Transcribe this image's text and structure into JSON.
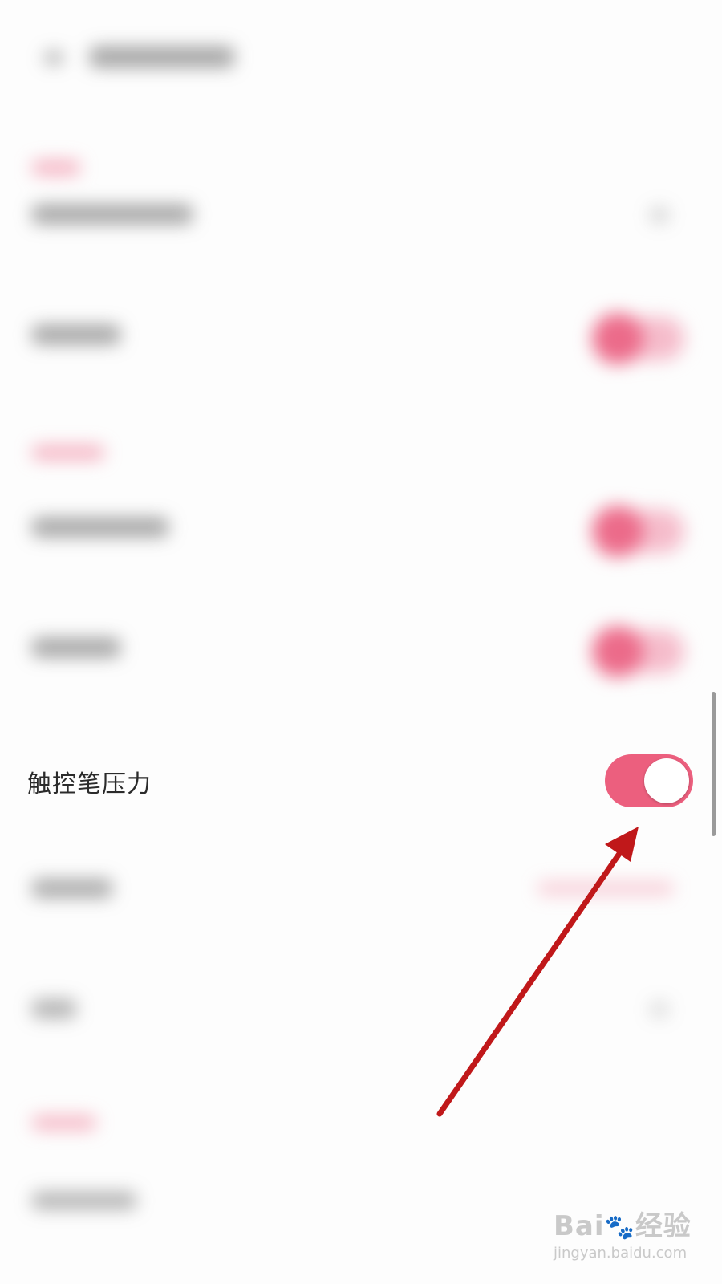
{
  "setting": {
    "label": "触控笔压力",
    "toggle_on": true
  },
  "watermark": {
    "logo_prefix": "Bai",
    "logo_suffix": "经验",
    "url": "jingyan.baidu.com"
  },
  "colors": {
    "accent": "#ec5f7e",
    "annotation_arrow": "#c0181a"
  }
}
